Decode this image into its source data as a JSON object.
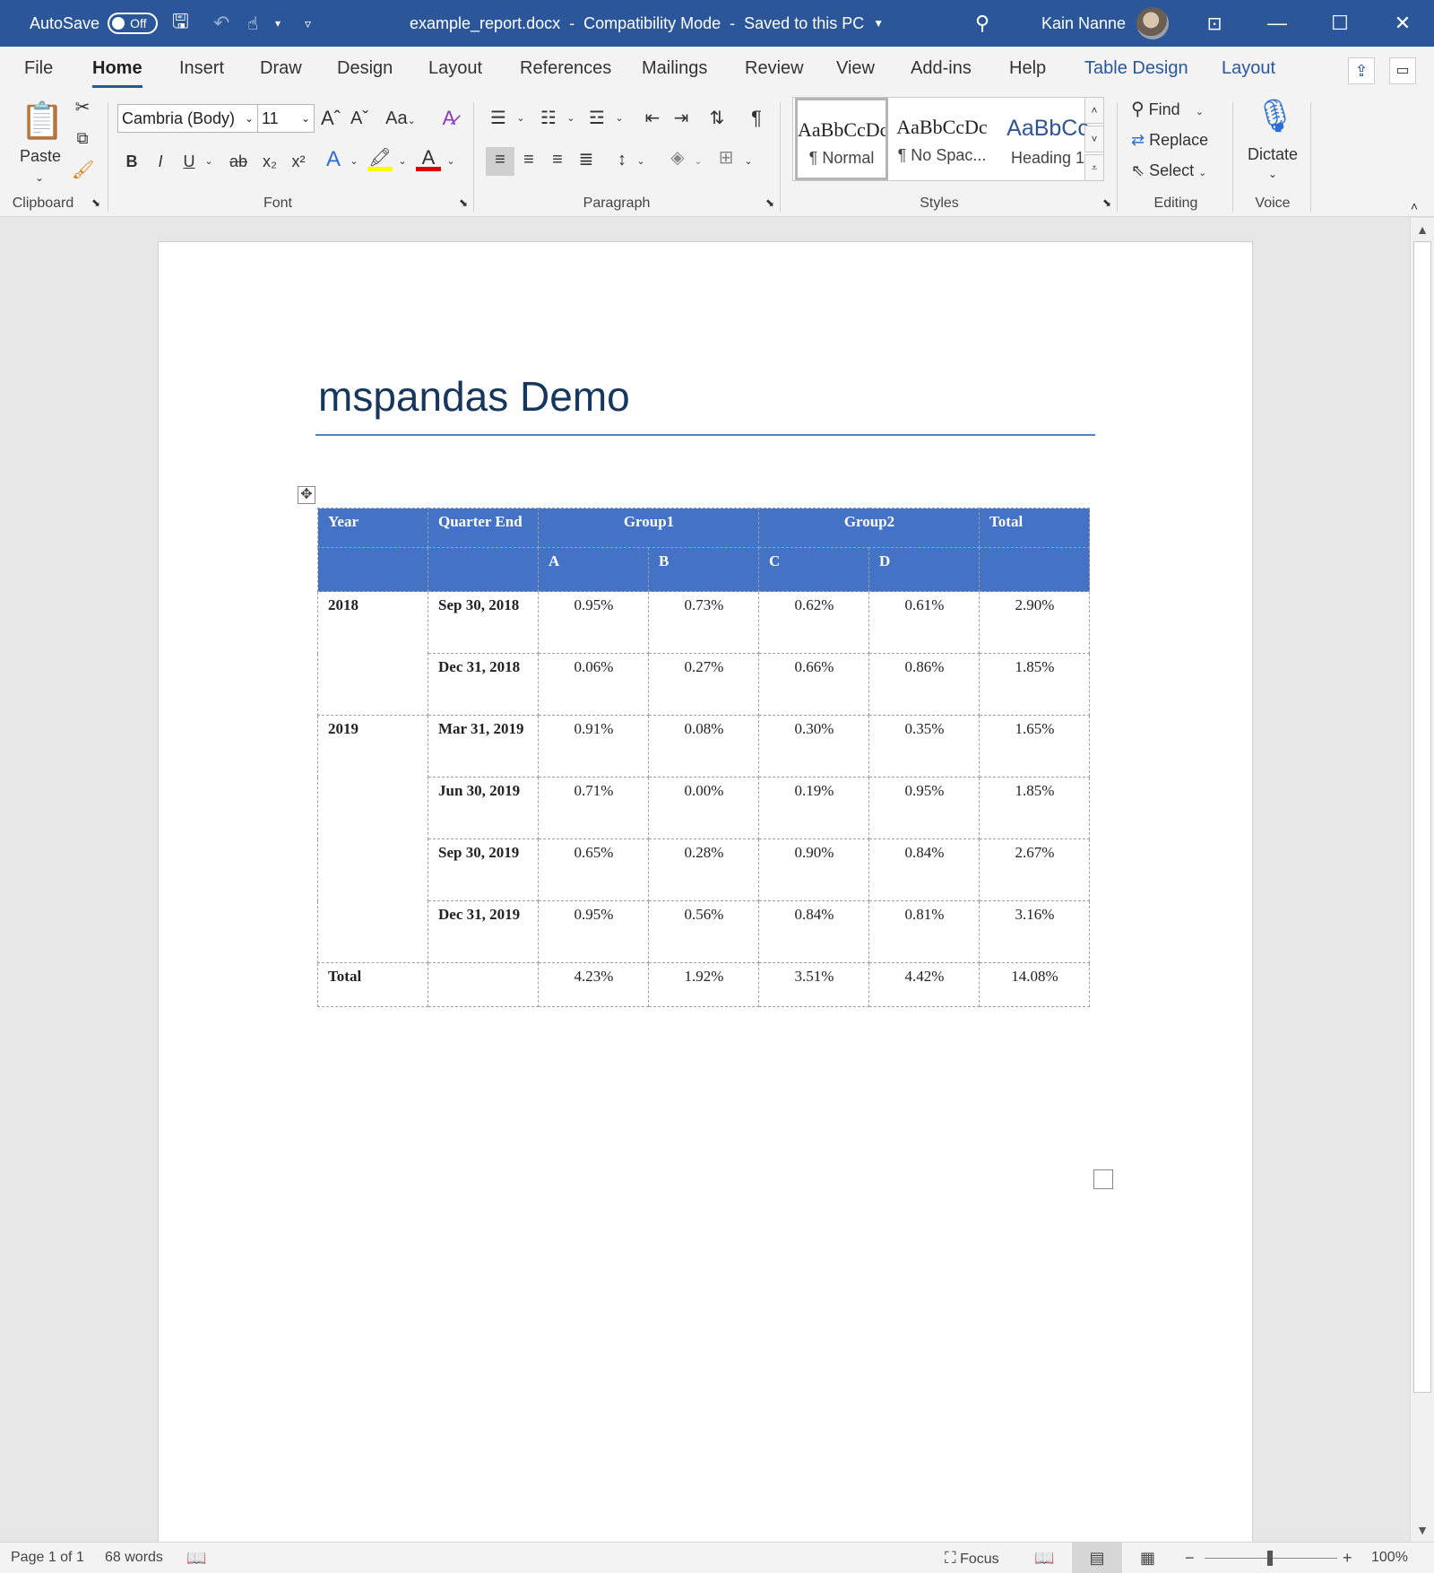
{
  "window": {
    "autosave_label": "AutoSave",
    "autosave_state": "Off",
    "title": "example_report.docx  -  Compatibility Mode  -  Saved to this PC",
    "user_name": "Kain Nanne",
    "accent_color": "#2b579a"
  },
  "tabs": {
    "file": "File",
    "home": "Home",
    "insert": "Insert",
    "draw": "Draw",
    "design": "Design",
    "layout": "Layout",
    "references": "References",
    "mailings": "Mailings",
    "review": "Review",
    "view": "View",
    "addins": "Add-ins",
    "help": "Help",
    "table_design": "Table Design",
    "table_layout": "Layout",
    "active": "Home"
  },
  "ribbon": {
    "clipboard": {
      "paste": "Paste",
      "label": "Clipboard"
    },
    "font": {
      "name": "Cambria (Body)",
      "size": "11",
      "change_case": "Aa",
      "label": "Font",
      "highlight_color": "#ffff00",
      "font_color": "#e00000"
    },
    "paragraph": {
      "label": "Paragraph"
    },
    "styles": {
      "label": "Styles",
      "items": [
        {
          "preview": "AaBbCcDc",
          "name": "¶ Normal"
        },
        {
          "preview": "AaBbCcDc",
          "name": "¶ No Spac..."
        },
        {
          "preview": "AaBbCc",
          "name": "Heading 1"
        }
      ]
    },
    "editing": {
      "find": "Find",
      "replace": "Replace",
      "select": "Select",
      "label": "Editing"
    },
    "voice": {
      "dictate": "Dictate",
      "label": "Voice"
    }
  },
  "document": {
    "title": "mspandas Demo",
    "table": {
      "header1": {
        "year": "Year",
        "quarter_end": "Quarter End",
        "group1": "Group1",
        "group2": "Group2",
        "total": "Total"
      },
      "header2": [
        "A",
        "B",
        "C",
        "D"
      ],
      "rows": [
        {
          "year": "2018",
          "quarter": "Sep 30, 2018",
          "values": [
            "0.95%",
            "0.73%",
            "0.62%",
            "0.61%",
            "2.90%"
          ]
        },
        {
          "year": "",
          "quarter": "Dec 31, 2018",
          "values": [
            "0.06%",
            "0.27%",
            "0.66%",
            "0.86%",
            "1.85%"
          ]
        },
        {
          "year": "2019",
          "quarter": "Mar 31, 2019",
          "values": [
            "0.91%",
            "0.08%",
            "0.30%",
            "0.35%",
            "1.65%"
          ]
        },
        {
          "year": "",
          "quarter": "Jun 30, 2019",
          "values": [
            "0.71%",
            "0.00%",
            "0.19%",
            "0.95%",
            "1.85%"
          ]
        },
        {
          "year": "",
          "quarter": "Sep 30, 2019",
          "values": [
            "0.65%",
            "0.28%",
            "0.90%",
            "0.84%",
            "2.67%"
          ]
        },
        {
          "year": "",
          "quarter": "Dec 31, 2019",
          "values": [
            "0.95%",
            "0.56%",
            "0.84%",
            "0.81%",
            "3.16%"
          ]
        }
      ],
      "total_row": {
        "label": "Total",
        "values": [
          "4.23%",
          "1.92%",
          "3.51%",
          "4.42%",
          "14.08%"
        ]
      },
      "header_color": "#4472c4"
    }
  },
  "status": {
    "page": "Page 1 of 1",
    "words": "68 words",
    "focus": "Focus",
    "zoom": "100%"
  }
}
